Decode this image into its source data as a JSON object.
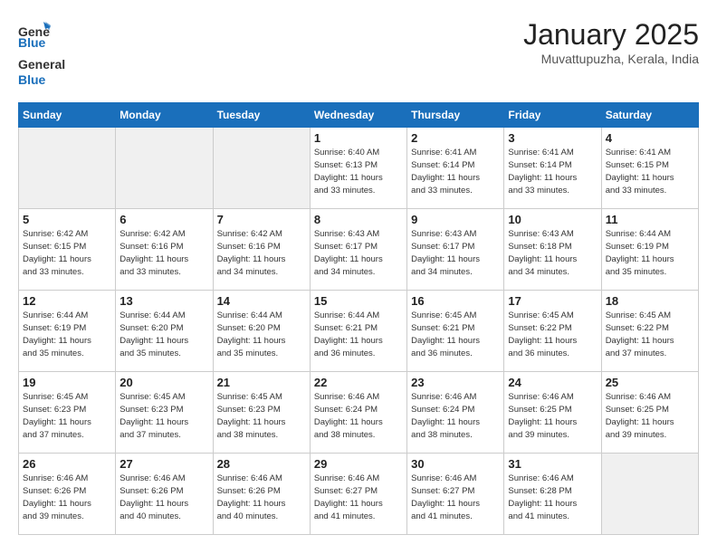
{
  "header": {
    "logo_line1": "General",
    "logo_line2": "Blue",
    "month": "January 2025",
    "location": "Muvattupuzha, Kerala, India"
  },
  "days_of_week": [
    "Sunday",
    "Monday",
    "Tuesday",
    "Wednesday",
    "Thursday",
    "Friday",
    "Saturday"
  ],
  "weeks": [
    [
      {
        "day": "",
        "info": "",
        "empty": true
      },
      {
        "day": "",
        "info": "",
        "empty": true
      },
      {
        "day": "",
        "info": "",
        "empty": true
      },
      {
        "day": "1",
        "info": "Sunrise: 6:40 AM\nSunset: 6:13 PM\nDaylight: 11 hours\nand 33 minutes.",
        "empty": false
      },
      {
        "day": "2",
        "info": "Sunrise: 6:41 AM\nSunset: 6:14 PM\nDaylight: 11 hours\nand 33 minutes.",
        "empty": false
      },
      {
        "day": "3",
        "info": "Sunrise: 6:41 AM\nSunset: 6:14 PM\nDaylight: 11 hours\nand 33 minutes.",
        "empty": false
      },
      {
        "day": "4",
        "info": "Sunrise: 6:41 AM\nSunset: 6:15 PM\nDaylight: 11 hours\nand 33 minutes.",
        "empty": false
      }
    ],
    [
      {
        "day": "5",
        "info": "Sunrise: 6:42 AM\nSunset: 6:15 PM\nDaylight: 11 hours\nand 33 minutes.",
        "empty": false
      },
      {
        "day": "6",
        "info": "Sunrise: 6:42 AM\nSunset: 6:16 PM\nDaylight: 11 hours\nand 33 minutes.",
        "empty": false
      },
      {
        "day": "7",
        "info": "Sunrise: 6:42 AM\nSunset: 6:16 PM\nDaylight: 11 hours\nand 34 minutes.",
        "empty": false
      },
      {
        "day": "8",
        "info": "Sunrise: 6:43 AM\nSunset: 6:17 PM\nDaylight: 11 hours\nand 34 minutes.",
        "empty": false
      },
      {
        "day": "9",
        "info": "Sunrise: 6:43 AM\nSunset: 6:17 PM\nDaylight: 11 hours\nand 34 minutes.",
        "empty": false
      },
      {
        "day": "10",
        "info": "Sunrise: 6:43 AM\nSunset: 6:18 PM\nDaylight: 11 hours\nand 34 minutes.",
        "empty": false
      },
      {
        "day": "11",
        "info": "Sunrise: 6:44 AM\nSunset: 6:19 PM\nDaylight: 11 hours\nand 35 minutes.",
        "empty": false
      }
    ],
    [
      {
        "day": "12",
        "info": "Sunrise: 6:44 AM\nSunset: 6:19 PM\nDaylight: 11 hours\nand 35 minutes.",
        "empty": false
      },
      {
        "day": "13",
        "info": "Sunrise: 6:44 AM\nSunset: 6:20 PM\nDaylight: 11 hours\nand 35 minutes.",
        "empty": false
      },
      {
        "day": "14",
        "info": "Sunrise: 6:44 AM\nSunset: 6:20 PM\nDaylight: 11 hours\nand 35 minutes.",
        "empty": false
      },
      {
        "day": "15",
        "info": "Sunrise: 6:44 AM\nSunset: 6:21 PM\nDaylight: 11 hours\nand 36 minutes.",
        "empty": false
      },
      {
        "day": "16",
        "info": "Sunrise: 6:45 AM\nSunset: 6:21 PM\nDaylight: 11 hours\nand 36 minutes.",
        "empty": false
      },
      {
        "day": "17",
        "info": "Sunrise: 6:45 AM\nSunset: 6:22 PM\nDaylight: 11 hours\nand 36 minutes.",
        "empty": false
      },
      {
        "day": "18",
        "info": "Sunrise: 6:45 AM\nSunset: 6:22 PM\nDaylight: 11 hours\nand 37 minutes.",
        "empty": false
      }
    ],
    [
      {
        "day": "19",
        "info": "Sunrise: 6:45 AM\nSunset: 6:23 PM\nDaylight: 11 hours\nand 37 minutes.",
        "empty": false
      },
      {
        "day": "20",
        "info": "Sunrise: 6:45 AM\nSunset: 6:23 PM\nDaylight: 11 hours\nand 37 minutes.",
        "empty": false
      },
      {
        "day": "21",
        "info": "Sunrise: 6:45 AM\nSunset: 6:23 PM\nDaylight: 11 hours\nand 38 minutes.",
        "empty": false
      },
      {
        "day": "22",
        "info": "Sunrise: 6:46 AM\nSunset: 6:24 PM\nDaylight: 11 hours\nand 38 minutes.",
        "empty": false
      },
      {
        "day": "23",
        "info": "Sunrise: 6:46 AM\nSunset: 6:24 PM\nDaylight: 11 hours\nand 38 minutes.",
        "empty": false
      },
      {
        "day": "24",
        "info": "Sunrise: 6:46 AM\nSunset: 6:25 PM\nDaylight: 11 hours\nand 39 minutes.",
        "empty": false
      },
      {
        "day": "25",
        "info": "Sunrise: 6:46 AM\nSunset: 6:25 PM\nDaylight: 11 hours\nand 39 minutes.",
        "empty": false
      }
    ],
    [
      {
        "day": "26",
        "info": "Sunrise: 6:46 AM\nSunset: 6:26 PM\nDaylight: 11 hours\nand 39 minutes.",
        "empty": false
      },
      {
        "day": "27",
        "info": "Sunrise: 6:46 AM\nSunset: 6:26 PM\nDaylight: 11 hours\nand 40 minutes.",
        "empty": false
      },
      {
        "day": "28",
        "info": "Sunrise: 6:46 AM\nSunset: 6:26 PM\nDaylight: 11 hours\nand 40 minutes.",
        "empty": false
      },
      {
        "day": "29",
        "info": "Sunrise: 6:46 AM\nSunset: 6:27 PM\nDaylight: 11 hours\nand 41 minutes.",
        "empty": false
      },
      {
        "day": "30",
        "info": "Sunrise: 6:46 AM\nSunset: 6:27 PM\nDaylight: 11 hours\nand 41 minutes.",
        "empty": false
      },
      {
        "day": "31",
        "info": "Sunrise: 6:46 AM\nSunset: 6:28 PM\nDaylight: 11 hours\nand 41 minutes.",
        "empty": false
      },
      {
        "day": "",
        "info": "",
        "empty": true
      }
    ]
  ]
}
